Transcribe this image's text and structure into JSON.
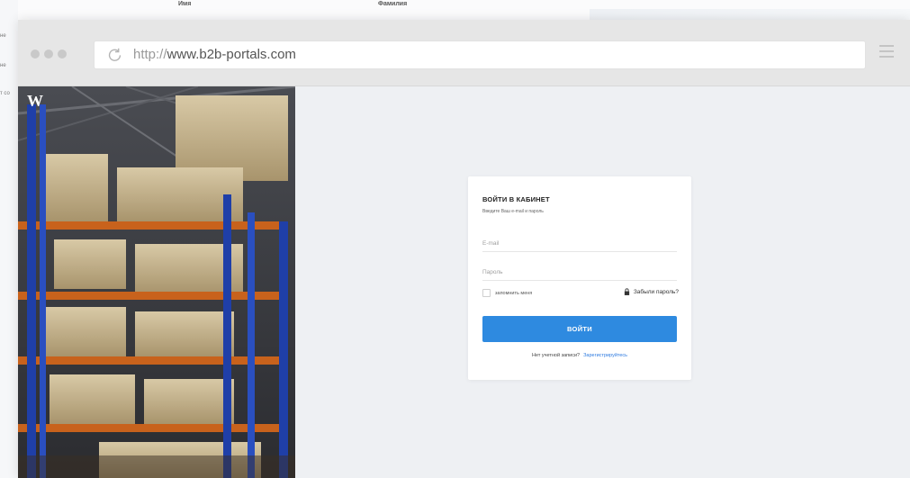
{
  "background_page": {
    "col_header_1": "Имя",
    "col_header_2": "Фамилия",
    "left_fragments": [
      "не",
      "не",
      "т со"
    ]
  },
  "browser": {
    "url_protocol": "http://",
    "url_domain": "www.b2b-portals.com"
  },
  "brand": {
    "logo_letter": "W"
  },
  "login": {
    "title": "ВОЙТИ В КАБИНЕТ",
    "subtitle": "Введите Ваш e-mail и пароль",
    "email_placeholder": "E-mail",
    "password_placeholder": "Пароль",
    "remember_label": "запомнить меня",
    "forgot_label": "Забыли пароль?",
    "submit_label": "ВОЙТИ",
    "no_account_text": "Нет учетной записи?",
    "register_link": "Зарегистрируйтесь"
  },
  "colors": {
    "primary_button": "#2e8ae0",
    "link": "#2e7be0",
    "toolbar": "#e6e6e6"
  }
}
